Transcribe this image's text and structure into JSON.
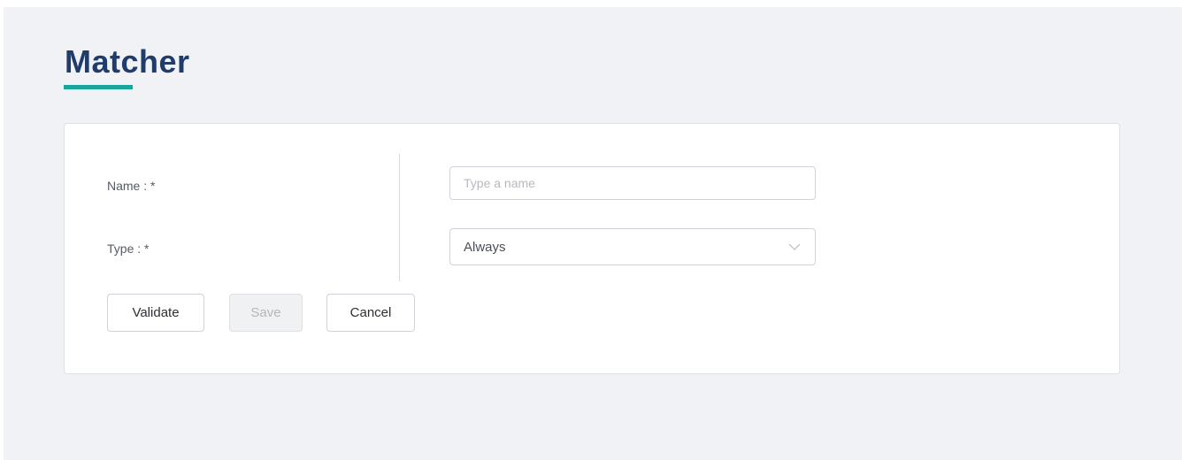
{
  "page": {
    "title": "Matcher"
  },
  "form": {
    "name_label": "Name : *",
    "name_placeholder": "Type a name",
    "name_value": "",
    "type_label": "Type : *",
    "type_selected": "Always"
  },
  "actions": {
    "validate_label": "Validate",
    "save_label": "Save",
    "cancel_label": "Cancel"
  },
  "colors": {
    "title": "#1f3c6b",
    "accent": "#1aa59a",
    "background": "#f1f2f6"
  },
  "icons": {
    "select_arrow": "chevron-down-icon"
  }
}
